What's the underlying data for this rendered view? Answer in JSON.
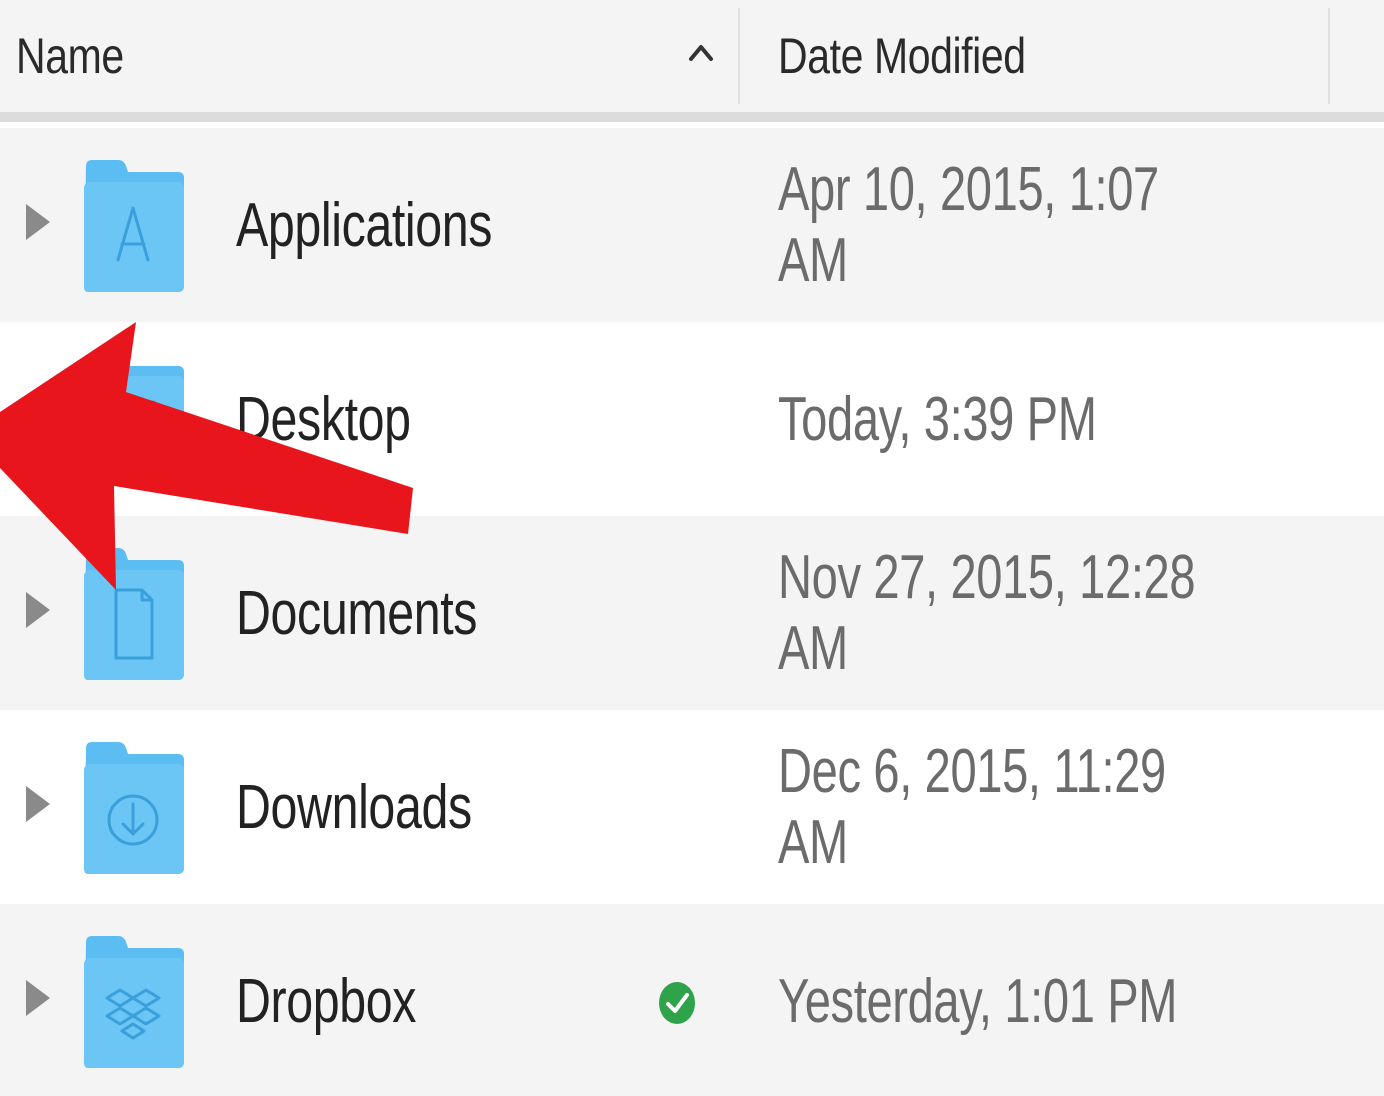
{
  "header": {
    "name_label": "Name",
    "date_label": "Date Modified",
    "sort_direction": "ascending"
  },
  "rows": [
    {
      "name": "Applications",
      "date": "Apr 10, 2015, 1:07 AM",
      "icon": "applications-folder-icon",
      "expandable": true
    },
    {
      "name": "Desktop",
      "date": "Today, 3:39 PM",
      "icon": "desktop-folder-icon",
      "expandable": false
    },
    {
      "name": "Documents",
      "date": "Nov 27, 2015, 12:28 AM",
      "icon": "documents-folder-icon",
      "expandable": true
    },
    {
      "name": "Downloads",
      "date": "Dec 6, 2015, 11:29 AM",
      "icon": "downloads-folder-icon",
      "expandable": true
    },
    {
      "name": "Dropbox",
      "date": "Yesterday, 1:01 PM",
      "icon": "dropbox-folder-icon",
      "expandable": true,
      "sync_status": "synced"
    }
  ],
  "colors": {
    "folder": "#5cbdf2",
    "folder_dark": "#3aa4e0",
    "arrow": "#e8151c",
    "sync_ok": "#2fa34a",
    "row_alt": "#f4f4f4"
  }
}
